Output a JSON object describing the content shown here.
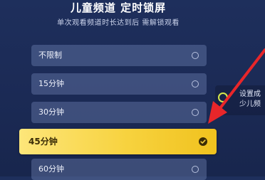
{
  "header": {
    "title": "儿童频道 定时锁屏",
    "subtitle": "单次观看频道时长达到后  需解锁观看"
  },
  "options": [
    {
      "label": "不限制",
      "selected": false
    },
    {
      "label": "15分钟",
      "selected": false
    },
    {
      "label": "30分钟",
      "selected": false
    },
    {
      "label": "45分钟",
      "selected": true
    },
    {
      "label": "60分钟",
      "selected": false
    }
  ],
  "side_hint": {
    "line1": "设置成",
    "line2": "少儿频"
  },
  "colors": {
    "background": "#1b2a55",
    "selected_option": "#f7d23e",
    "annotation_arrow": "#e8262a",
    "side_icon": "#d5e84b"
  }
}
